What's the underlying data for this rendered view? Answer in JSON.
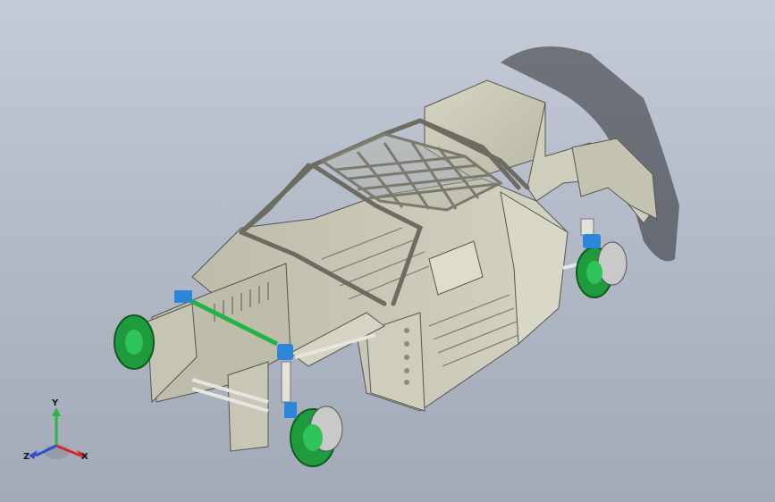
{
  "viewport": {
    "background_top": "#c5cbd6",
    "background_bottom": "#a2a9b7",
    "model_body_color": "#c9c8b6",
    "accent_green": "#22b34a",
    "accent_blue": "#2e86d9"
  },
  "triad": {
    "x_label": "X",
    "y_label": "Y",
    "z_label": "Z",
    "x_color": "#d42a2a",
    "y_color": "#2fb344",
    "z_color": "#2a4fd4"
  }
}
